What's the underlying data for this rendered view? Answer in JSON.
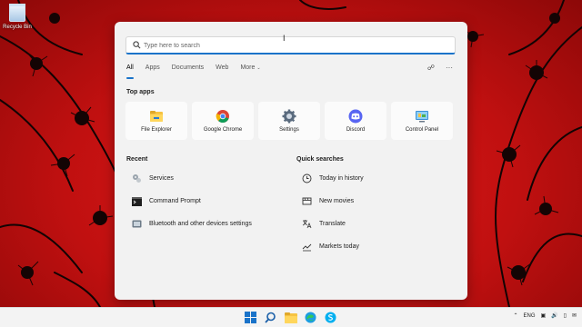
{
  "desktop": {
    "recycle_bin_label": "Recycle Bin"
  },
  "search": {
    "placeholder": "Type here to search"
  },
  "tabs": [
    {
      "label": "All"
    },
    {
      "label": "Apps"
    },
    {
      "label": "Documents"
    },
    {
      "label": "Web"
    },
    {
      "label": "More"
    }
  ],
  "top_apps": {
    "title": "Top apps",
    "items": [
      {
        "label": "File Explorer",
        "icon": "file-explorer-icon"
      },
      {
        "label": "Google Chrome",
        "icon": "chrome-icon"
      },
      {
        "label": "Settings",
        "icon": "settings-gear-icon"
      },
      {
        "label": "Discord",
        "icon": "discord-icon"
      },
      {
        "label": "Control Panel",
        "icon": "control-panel-icon"
      }
    ]
  },
  "recent": {
    "title": "Recent",
    "items": [
      {
        "label": "Services",
        "icon": "services-icon"
      },
      {
        "label": "Command Prompt",
        "icon": "command-prompt-icon"
      },
      {
        "label": "Bluetooth and other devices settings",
        "icon": "bluetooth-settings-icon"
      }
    ]
  },
  "quick_searches": {
    "title": "Quick searches",
    "items": [
      {
        "label": "Today in history",
        "icon": "clock-icon"
      },
      {
        "label": "New movies",
        "icon": "movie-icon"
      },
      {
        "label": "Translate",
        "icon": "translate-icon"
      },
      {
        "label": "Markets today",
        "icon": "chart-icon"
      }
    ]
  },
  "taskbar": {
    "language": "ENG"
  },
  "colors": {
    "accent": "#1a73c9",
    "wallpaper": "#c41212",
    "panel": "#f2f2f2"
  }
}
